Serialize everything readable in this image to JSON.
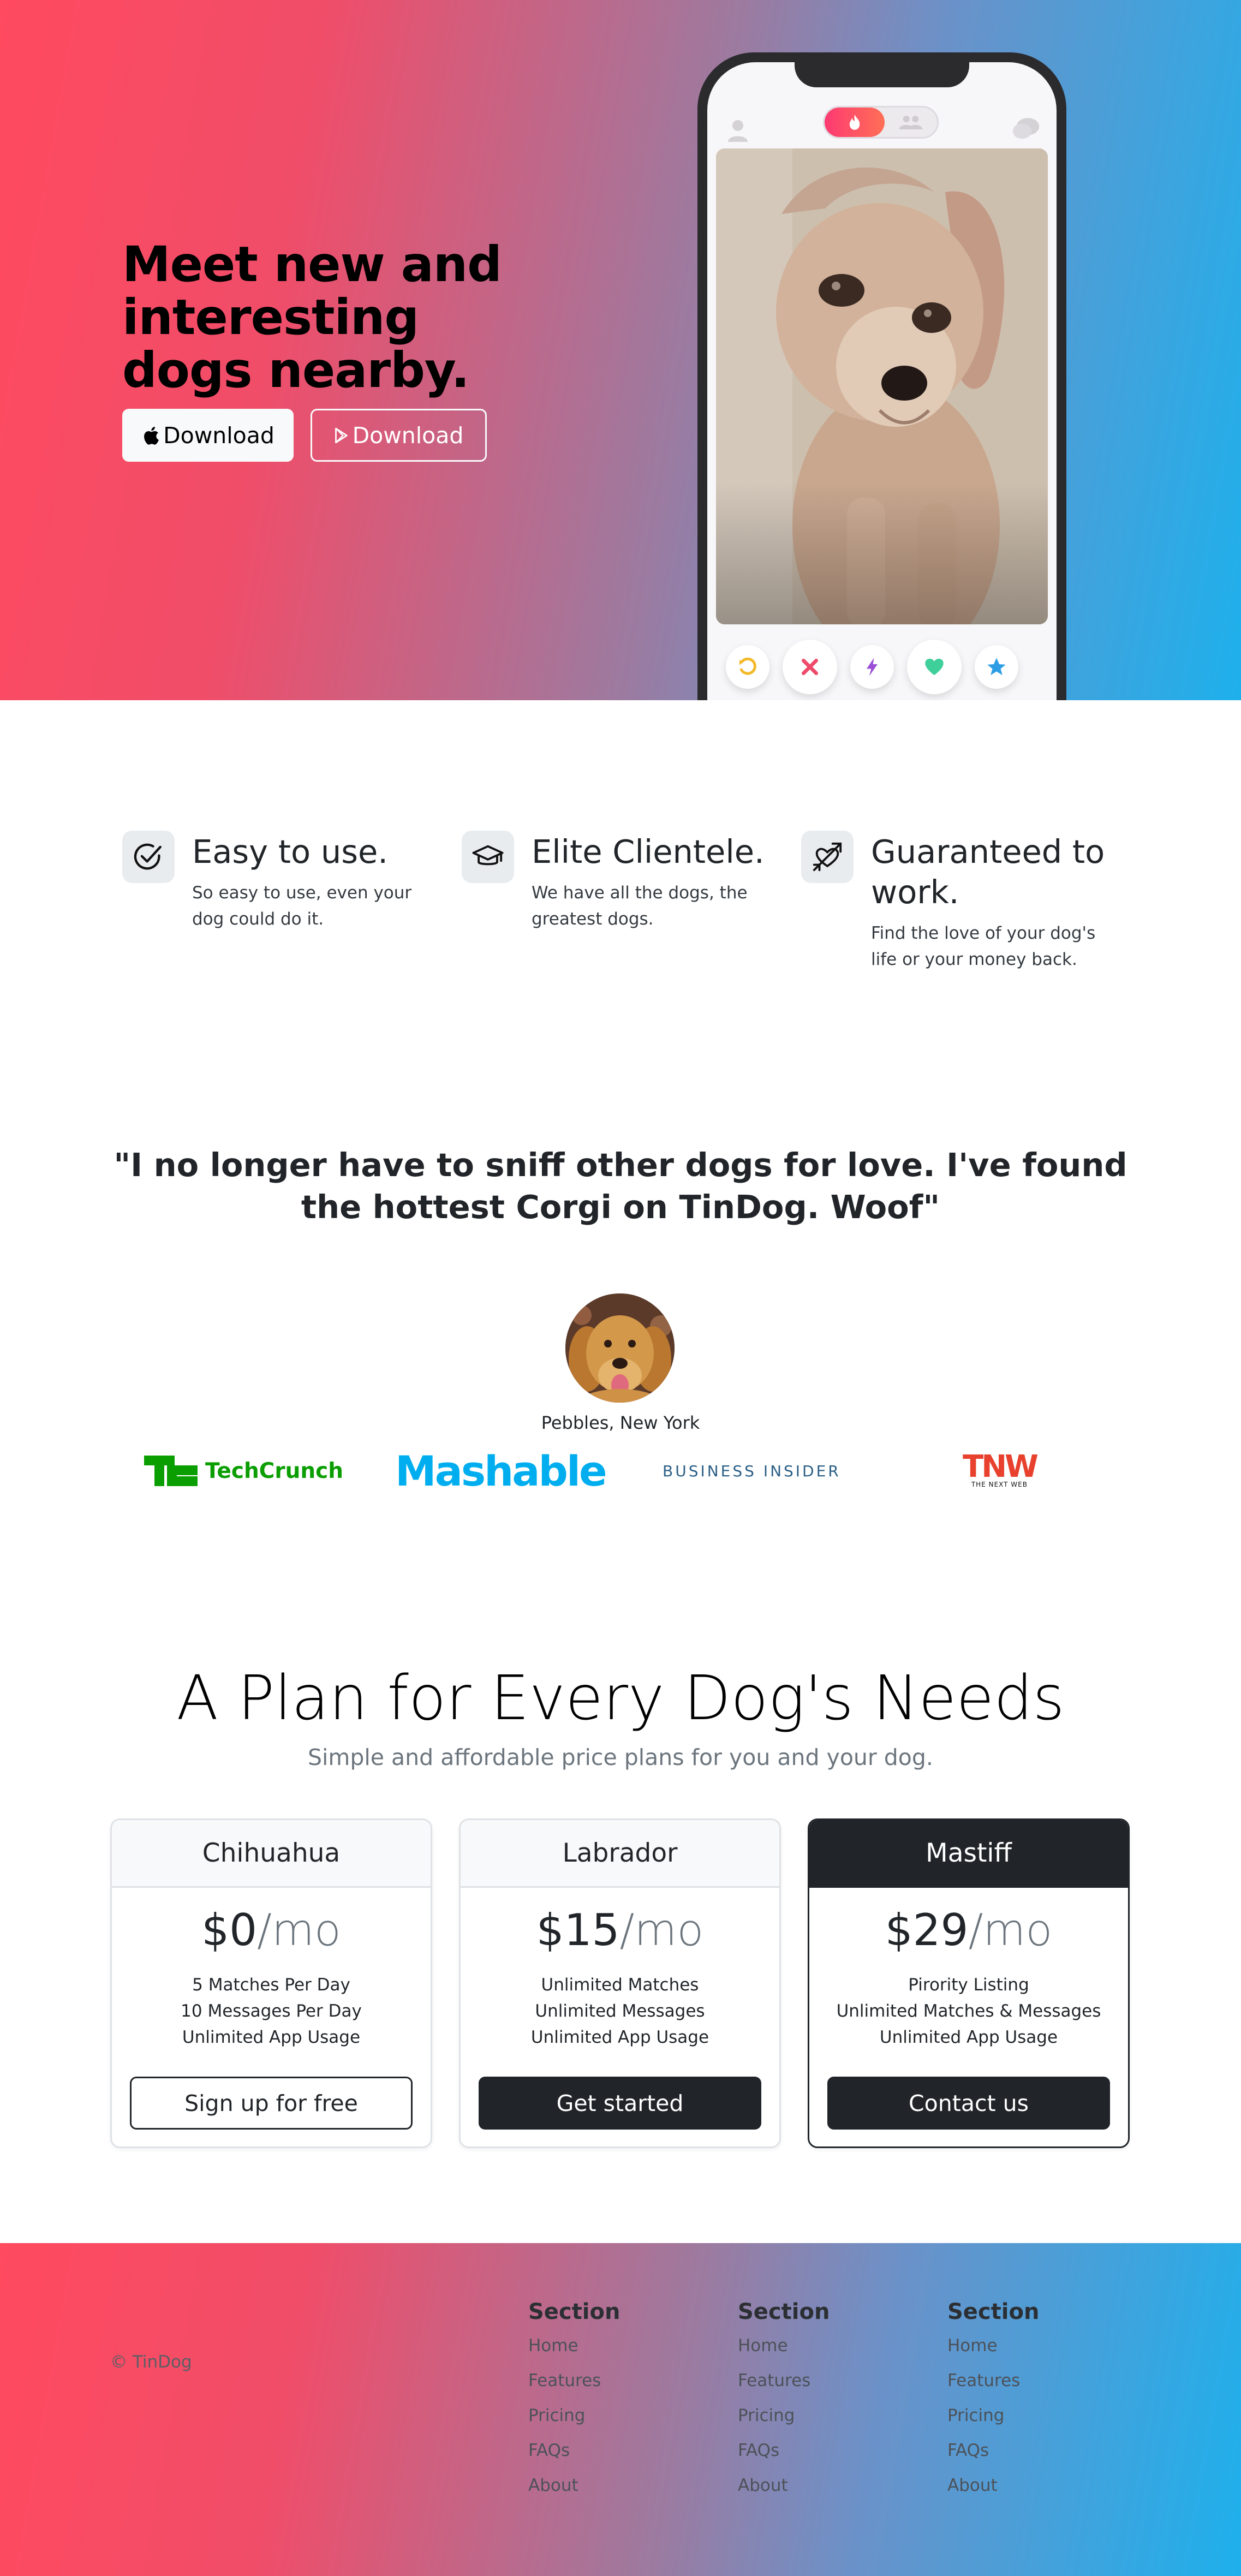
{
  "hero": {
    "title": "Meet new and interesting dogs nearby.",
    "apple_button": "Download",
    "play_button": "Download"
  },
  "features": [
    {
      "icon": "check-circle-icon",
      "title": "Easy to use.",
      "text": "So easy to use, even your dog could do it."
    },
    {
      "icon": "graduation-cap-icon",
      "title": "Elite Clientele.",
      "text": "We have all the dogs, the greatest dogs."
    },
    {
      "icon": "heart-arrow-icon",
      "title": "Guaranteed to work.",
      "text": "Find the love of your dog's life or your money back."
    }
  ],
  "testimonial": {
    "quote": "\"I no longer have to sniff other dogs for love. I've found the hottest Corgi on TinDog. Woof\"",
    "author": "Pebbles, New York"
  },
  "press": {
    "techcrunch": "TechCrunch",
    "mashable": "Mashable",
    "business_insider": "BUSINESS INSIDER",
    "tnw": "TNW",
    "tnw_sub": "THE NEXT WEB"
  },
  "pricing": {
    "title": "A Plan for Every Dog's Needs",
    "subtitle": "Simple and affordable price plans for you and your dog.",
    "per": "/mo",
    "plans": [
      {
        "name": "Chihuahua",
        "price": "$0",
        "features": [
          "5 Matches Per Day",
          "10 Messages Per Day",
          "Unlimited App Usage"
        ],
        "button": "Sign up for free"
      },
      {
        "name": "Labrador",
        "price": "$15",
        "features": [
          "Unlimited Matches",
          "Unlimited Messages",
          "Unlimited App Usage"
        ],
        "button": "Get started"
      },
      {
        "name": "Mastiff",
        "price": "$29",
        "features": [
          "Pirority Listing",
          "Unlimited Matches & Messages",
          "Unlimited App Usage"
        ],
        "button": "Contact us"
      }
    ]
  },
  "footer": {
    "copyright": "© TinDog",
    "columns": [
      {
        "title": "Section",
        "links": [
          "Home",
          "Features",
          "Pricing",
          "FAQs",
          "About"
        ]
      },
      {
        "title": "Section",
        "links": [
          "Home",
          "Features",
          "Pricing",
          "FAQs",
          "About"
        ]
      },
      {
        "title": "Section",
        "links": [
          "Home",
          "Features",
          "Pricing",
          "FAQs",
          "About"
        ]
      }
    ]
  },
  "colors": {
    "gradient_start": "#ff4a5f",
    "gradient_end": "#1eb0ec",
    "dark": "#212529"
  }
}
